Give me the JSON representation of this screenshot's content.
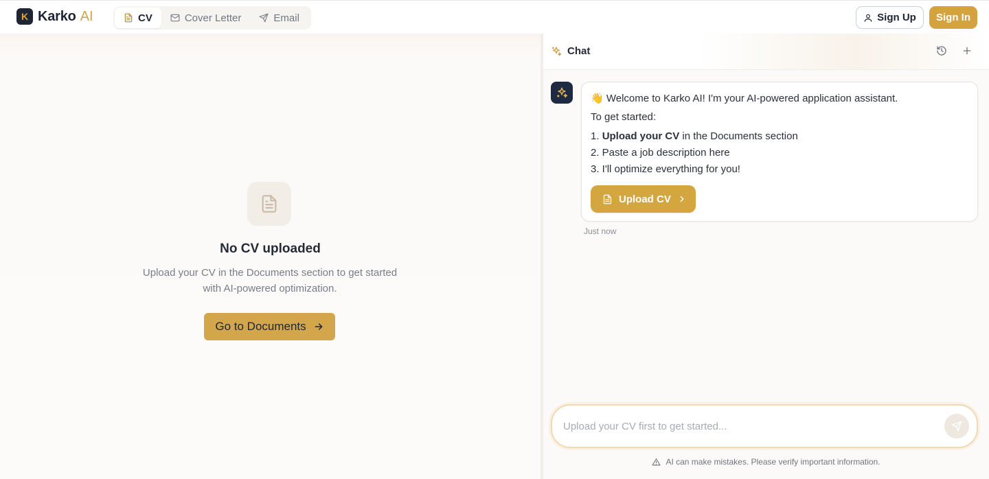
{
  "app": {
    "logo_letter": "K",
    "name": "Karko",
    "name_suffix": "AI"
  },
  "tabs": [
    {
      "label": "CV",
      "icon": "document-icon",
      "active": true
    },
    {
      "label": "Cover Letter",
      "icon": "mail-icon",
      "active": false
    },
    {
      "label": "Email",
      "icon": "send-icon",
      "active": false
    }
  ],
  "auth": {
    "sign_up_label": "Sign Up",
    "sign_in_label": "Sign In"
  },
  "empty_state": {
    "title": "No CV uploaded",
    "description_line1": "Upload your CV in the Documents section to get started",
    "description_line2": "with AI-powered optimization.",
    "button_label": "Go to Documents"
  },
  "chat": {
    "title": "Chat",
    "message": {
      "greeting_emoji": "👋",
      "greeting": "Welcome to Karko AI! I'm your AI-powered application assistant.",
      "intro": "To get started:",
      "step1_num": "1.",
      "step1_bold": "Upload your CV",
      "step1_rest": "in the Documents section",
      "step2": "2. Paste a job description here",
      "step3": "3. I'll optimize everything for you!",
      "button_label": "Upload CV",
      "timestamp": "Just now"
    },
    "input_placeholder": "Upload your CV first to get started...",
    "disclaimer": "AI can make mistakes. Please verify important information."
  },
  "colors": {
    "accent": "#d4a640",
    "dark": "#1e2535",
    "page_bg": "#fbf9f6"
  }
}
